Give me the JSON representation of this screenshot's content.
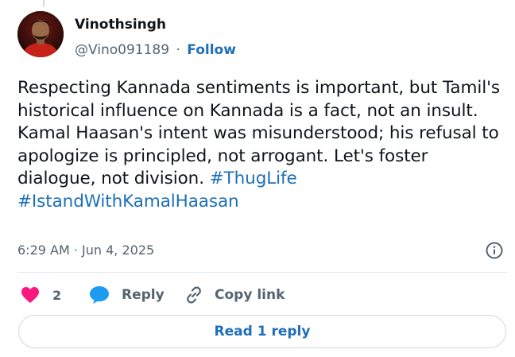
{
  "author": {
    "display_name": "Vinothsingh",
    "handle": "@Vino091189",
    "separator": "·",
    "follow_label": "Follow"
  },
  "tweet": {
    "text": "Respecting Kannada sentiments is important, but Tamil's historical influence on Kannada is a fact, not an insult. Kamal Haasan's intent was misunderstood; his refusal to apologize is principled, not arrogant. Let's foster dialogue, not division.",
    "hashtags": [
      "#ThugLife",
      "#IstandWithKamalHaasan"
    ],
    "timestamp": "6:29 AM · Jun 4, 2025"
  },
  "actions": {
    "like_count": "2",
    "reply_label": "Reply",
    "copy_link_label": "Copy link"
  },
  "read_replies_label": "Read 1 reply",
  "icons": {
    "like": "heart-icon",
    "reply": "speech-bubble-icon",
    "copy": "link-icon",
    "info": "info-icon"
  },
  "colors": {
    "like": "#f91880",
    "reply": "#1d9bf0",
    "link": "#1d6fb8",
    "secondary_text": "#536471"
  }
}
